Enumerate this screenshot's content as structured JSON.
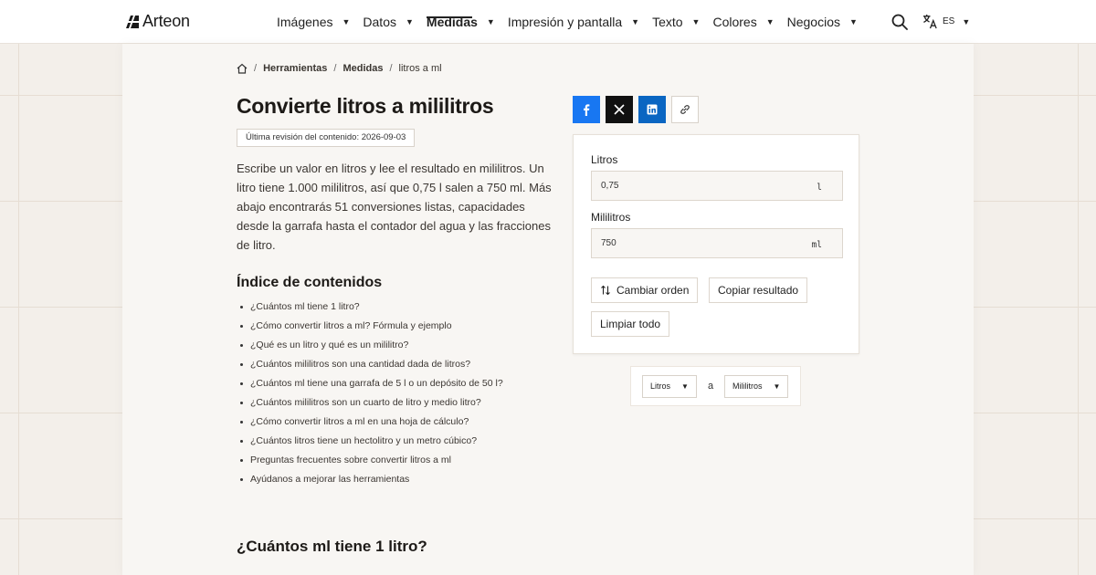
{
  "brand": {
    "name": "Arteon"
  },
  "nav": {
    "items": [
      {
        "label": "Imágenes"
      },
      {
        "label": "Datos"
      },
      {
        "label": "Medidas",
        "active": true
      },
      {
        "label": "Impresión y pantalla"
      },
      {
        "label": "Texto"
      },
      {
        "label": "Colores"
      },
      {
        "label": "Negocios"
      }
    ],
    "lang": "ES"
  },
  "breadcrumb": {
    "items": [
      "Herramientas",
      "Medidas",
      "litros a ml"
    ]
  },
  "page": {
    "title": "Convierte litros a mililitros",
    "revision": "Última revisión del contenido: 2026-09-03",
    "intro": "Escribe un valor en litros y lee el resultado en mililitros. Un litro tiene 1.000 mililitros, así que 0,75 l salen a 750 ml. Más abajo encontrarás 51 conversiones listas, capacidades desde la garrafa hasta el contador del agua y las fracciones de litro.",
    "toc_title": "Índice de contenidos",
    "toc": [
      "¿Cuántos ml tiene 1 litro?",
      "¿Cómo convertir litros a ml? Fórmula y ejemplo",
      "¿Qué es un litro y qué es un mililitro?",
      "¿Cuántos mililitros son una cantidad dada de litros?",
      "¿Cuántos ml tiene una garrafa de 5 l o un depósito de 50 l?",
      "¿Cuántos mililitros son un cuarto de litro y medio litro?",
      "¿Cómo convertir litros a ml en una hoja de cálculo?",
      "¿Cuántos litros tiene un hectolitro y un metro cúbico?",
      "Preguntas frecuentes sobre convertir litros a ml",
      "Ayúdanos a mejorar las herramientas"
    ],
    "section_title": "¿Cuántos ml tiene 1 litro?"
  },
  "share": {
    "icons": [
      "facebook-icon",
      "x-icon",
      "linkedin-icon",
      "link-icon"
    ]
  },
  "converter": {
    "from_label": "Litros",
    "from_value": "0,75",
    "from_unit": "l",
    "to_label": "Mililitros",
    "to_value": "750",
    "to_unit": "ml",
    "swap_label": "Cambiar orden",
    "copy_label": "Copiar resultado",
    "clear_label": "Limpiar todo"
  },
  "unit_selector": {
    "from": "Litros",
    "connector": "a",
    "to": "Mililitros"
  },
  "colors": {
    "facebook": "#1877f2",
    "x": "#111111",
    "linkedin": "#0a66c2",
    "background": "#f3efea"
  }
}
